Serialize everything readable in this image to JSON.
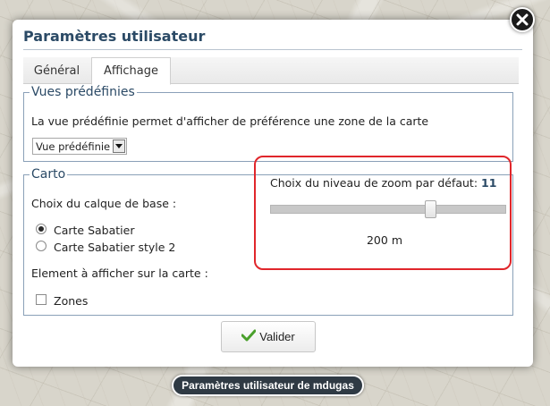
{
  "dialog": {
    "title": "Paramètres utilisateur",
    "close_icon": "close-icon"
  },
  "tabs": [
    {
      "label": "Général",
      "active": false
    },
    {
      "label": "Affichage",
      "active": true
    }
  ],
  "vues": {
    "legend": "Vues prédéfinies",
    "description": "La vue prédéfinie permet d'afficher de préférence une zone de la carte",
    "select_value": "Vue prédéfinie"
  },
  "carto": {
    "legend": "Carto",
    "base_layer_label": "Choix du calque de base :",
    "base_layers": [
      {
        "label": "Carte Sabatier",
        "checked": true
      },
      {
        "label": "Carte Sabatier style 2",
        "checked": false
      }
    ],
    "elements_label": "Element à afficher sur la carte :",
    "elements": [
      {
        "label": "Zones",
        "checked": false
      }
    ],
    "zoom": {
      "label": "Choix du niveau de zoom par défaut:",
      "value": "11",
      "slider_fraction": 0.69,
      "scale_text": "200 m",
      "highlight_color": "#e0262b"
    }
  },
  "actions": {
    "validate_label": "Valider",
    "validate_icon": "checkmark-icon"
  },
  "footer": {
    "label": "Paramètres utilisateur de mdugas"
  },
  "colors": {
    "title": "#2b4a66",
    "accent_check": "#4aa02c"
  }
}
